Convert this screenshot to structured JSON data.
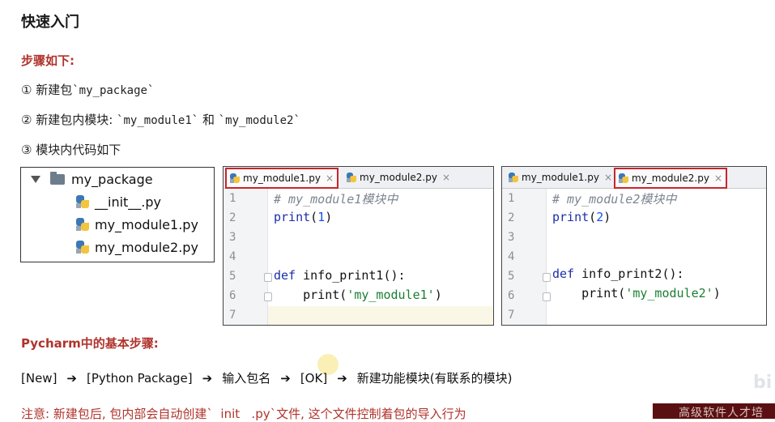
{
  "title": "快速入门",
  "steps_heading": "步骤如下:",
  "steps": [
    {
      "marker": "①",
      "text": " 新建包",
      "code": "`my_package`"
    },
    {
      "marker": "②",
      "text": " 新建包内模块: ",
      "code1": "`my_module1`",
      "mid": " 和 ",
      "code2": "`my_module2`"
    },
    {
      "marker": "③",
      "text": " 模块内代码如下"
    }
  ],
  "project_tree": {
    "folder": "my_package",
    "files": [
      "__init__.py",
      "my_module1.py",
      "my_module2.py"
    ]
  },
  "editor1": {
    "tabs": [
      {
        "label": "my_module1.py",
        "active": true
      },
      {
        "label": "my_module2.py",
        "active": false
      }
    ],
    "line_numbers": [
      "1",
      "2",
      "3",
      "4",
      "5",
      "6",
      "7"
    ],
    "code": {
      "l1": "# my_module1模块中",
      "l2_fn": "print",
      "l2_open": "(",
      "l2_num": "1",
      "l2_close": ")",
      "l5_kw": "def",
      "l5_rest": " info_print1():",
      "l6_fn": "    print(",
      "l6_str": "'my_module1'",
      "l6_close": ")"
    }
  },
  "editor2": {
    "tabs": [
      {
        "label": "my_module1.py",
        "active": false
      },
      {
        "label": "my_module2.py",
        "active": true
      }
    ],
    "line_numbers": [
      "1",
      "2",
      "3",
      "4",
      "5",
      "6",
      "7"
    ],
    "code": {
      "l1": "# my_module2模块中",
      "l2_fn": "print",
      "l2_open": "(",
      "l2_num": "2",
      "l2_close": ")",
      "l5_kw": "def",
      "l5_rest": " info_print2():",
      "l6_fn": "    print(",
      "l6_str": "'my_module2'",
      "l6_close": ")"
    }
  },
  "pycharm_heading": "Pycharm中的基本步骤:",
  "flow": [
    "[New]",
    "[Python Package]",
    "输入包名",
    "[OK]",
    "新建功能模块(有联系的模块)"
  ],
  "flow_arrow": "➔",
  "note": "注意: 新建包后, 包内部会自动创建`  init   .py`文件, 这个文件控制着包的导入行为",
  "banner": "高级软件人才培",
  "colors": {
    "accent": "#b0332c",
    "tab_highlight": "#c9252c"
  },
  "icons": [
    "triangle-down-icon",
    "folder-icon",
    "python-file-icon",
    "close-icon"
  ]
}
